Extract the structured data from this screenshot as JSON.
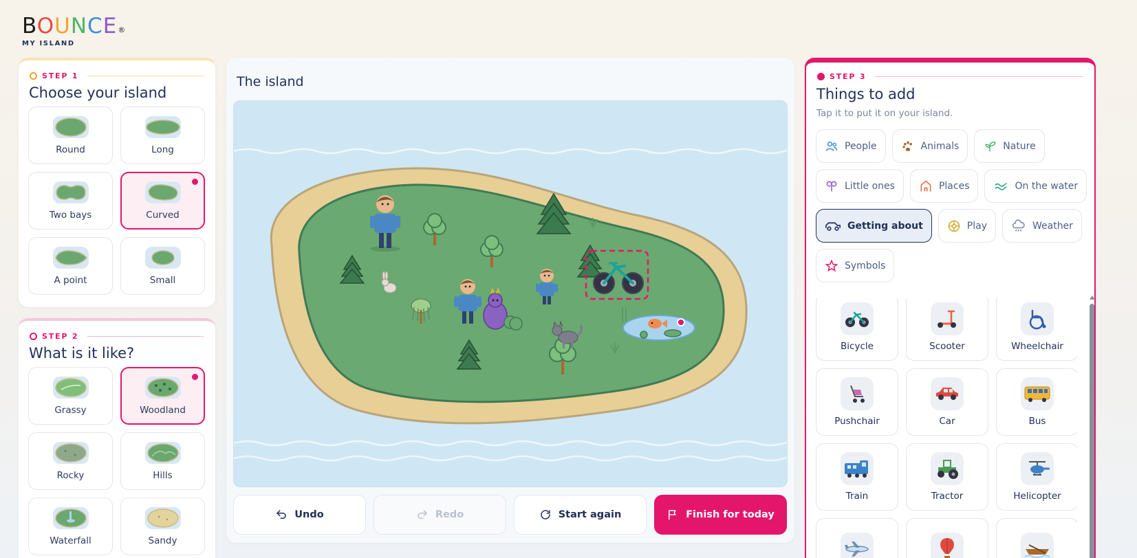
{
  "brand": {
    "letters": [
      "B",
      "O",
      "U",
      "N",
      "C",
      "E"
    ],
    "reg": "®",
    "sub": "MY ISLAND"
  },
  "step1": {
    "step": "STEP 1",
    "title": "Choose your island",
    "accent": "#f3a42a",
    "options": [
      {
        "label": "Round",
        "selected": false
      },
      {
        "label": "Long",
        "selected": false
      },
      {
        "label": "Two bays",
        "selected": false
      },
      {
        "label": "Curved",
        "selected": true
      },
      {
        "label": "A point",
        "selected": false
      },
      {
        "label": "Small",
        "selected": false
      }
    ]
  },
  "step2": {
    "step": "STEP 2",
    "title": "What is it like?",
    "accent": "#e3166b",
    "options": [
      {
        "label": "Grassy",
        "selected": false
      },
      {
        "label": "Woodland",
        "selected": true
      },
      {
        "label": "Rocky",
        "selected": false
      },
      {
        "label": "Hills",
        "selected": false
      },
      {
        "label": "Waterfall",
        "selected": false
      },
      {
        "label": "Sandy",
        "selected": false
      }
    ]
  },
  "island": {
    "title": "The island",
    "placed": [
      "person-adult",
      "tree",
      "tree",
      "pine-tree",
      "pine-tree",
      "pine-tree",
      "rabbit",
      "person-adult",
      "person-child",
      "bicycle-selected",
      "willow-tree",
      "purple-monster",
      "cat",
      "tree",
      "pine-tree",
      "pond-with-fish",
      "grass"
    ]
  },
  "actions": {
    "undo": "Undo",
    "redo": "Redo",
    "start_again": "Start again",
    "finish": "Finish for today"
  },
  "step3": {
    "step": "STEP 3",
    "title": "Things to add",
    "hint": "Tap it to put it on your island.",
    "categories": [
      {
        "label": "People",
        "icon": "people-icon",
        "selected": false
      },
      {
        "label": "Animals",
        "icon": "paw-icon",
        "selected": false
      },
      {
        "label": "Nature",
        "icon": "sprout-icon",
        "selected": false
      },
      {
        "label": "Little ones",
        "icon": "rattle-icon",
        "selected": false
      },
      {
        "label": "Places",
        "icon": "house-icon",
        "selected": false
      },
      {
        "label": "On the water",
        "icon": "waves-icon",
        "selected": false
      },
      {
        "label": "Getting about",
        "icon": "car-icon",
        "selected": true
      },
      {
        "label": "Play",
        "icon": "ball-icon",
        "selected": false
      },
      {
        "label": "Weather",
        "icon": "cloud-rain-icon",
        "selected": false
      },
      {
        "label": "Symbols",
        "icon": "star-icon",
        "selected": false
      }
    ],
    "items": [
      {
        "label": "Bicycle",
        "icon": "bicycle-icon"
      },
      {
        "label": "Scooter",
        "icon": "scooter-icon"
      },
      {
        "label": "Wheelchair",
        "icon": "wheelchair-icon"
      },
      {
        "label": "Pushchair",
        "icon": "pushchair-icon"
      },
      {
        "label": "Car",
        "icon": "car-icon"
      },
      {
        "label": "Bus",
        "icon": "bus-icon"
      },
      {
        "label": "Train",
        "icon": "train-icon"
      },
      {
        "label": "Tractor",
        "icon": "tractor-icon"
      },
      {
        "label": "Helicopter",
        "icon": "helicopter-icon"
      },
      {
        "label": "",
        "icon": "plane-icon"
      },
      {
        "label": "",
        "icon": "hot-air-balloon-icon"
      },
      {
        "label": "",
        "icon": "rowing-boat-icon"
      }
    ]
  }
}
